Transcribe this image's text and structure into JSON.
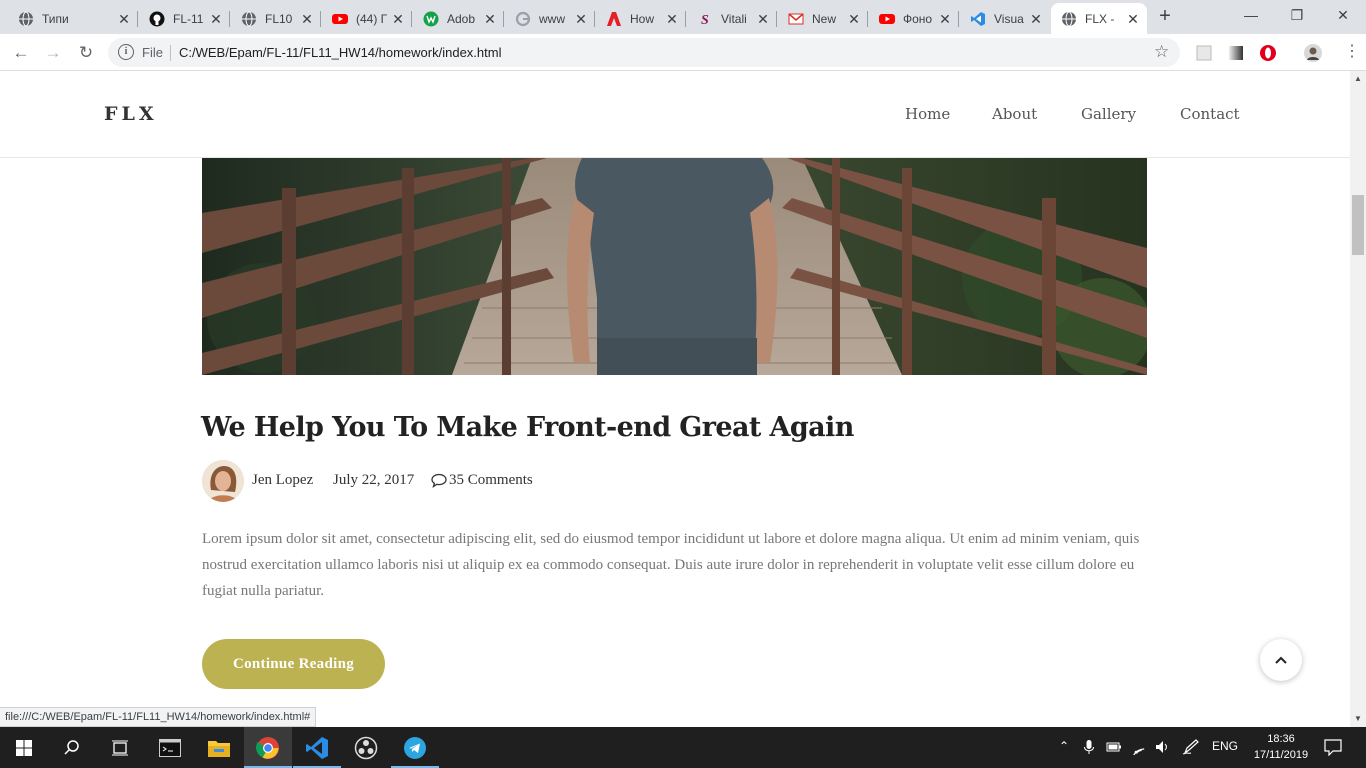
{
  "browser": {
    "tabs": [
      {
        "label": "Типи",
        "fav": "globe",
        "active": false
      },
      {
        "label": "FL-11",
        "fav": "github",
        "active": false
      },
      {
        "label": "FL10",
        "fav": "globe",
        "active": false
      },
      {
        "label": "(44) Г",
        "fav": "youtube",
        "active": false
      },
      {
        "label": "Adob",
        "fav": "green",
        "active": false
      },
      {
        "label": "www",
        "fav": "google",
        "active": false
      },
      {
        "label": "How",
        "fav": "adobe",
        "active": false
      },
      {
        "label": "Vitali",
        "fav": "script",
        "active": false
      },
      {
        "label": "New",
        "fav": "gmail",
        "active": false
      },
      {
        "label": "Фоно",
        "fav": "youtube",
        "active": false
      },
      {
        "label": "Visua",
        "fav": "vscode",
        "active": false
      },
      {
        "label": "FLX -",
        "fav": "globe",
        "active": true
      }
    ],
    "new_tab": "+",
    "omnibox": {
      "scheme_label": "File",
      "url": "C:/WEB/Epam/FL-11/FL11_HW14/homework/index.html"
    },
    "status_url": "file:///C:/WEB/Epam/FL-11/FL11_HW14/homework/index.html#"
  },
  "site": {
    "logo": "FLX",
    "nav": [
      {
        "label": "Home",
        "current": true
      },
      {
        "label": "About",
        "current": false
      },
      {
        "label": "Gallery",
        "current": false
      },
      {
        "label": "Contact",
        "current": false
      }
    ],
    "post": {
      "title": "We Help You To Make Front-end Great Again",
      "author": "Jen Lopez",
      "date": "July 22, 2017",
      "comments": "35 Comments",
      "excerpt": "Lorem ipsum dolor sit amet, consectetur adipiscing elit, sed do eiusmod tempor incididunt ut labore et dolore magna aliqua. Ut enim ad minim veniam, quis nostrud exercitation ullamco laboris nisi ut aliquip ex ea commodo consequat. Duis aute irure dolor in reprehenderit in voluptate velit esse cillum dolore eu fugiat nulla pariatur.",
      "cta": "Continue Reading"
    },
    "accent_color": "#bdb252"
  },
  "taskbar": {
    "language": "ENG",
    "time": "18:36",
    "date": "17/11/2019"
  }
}
